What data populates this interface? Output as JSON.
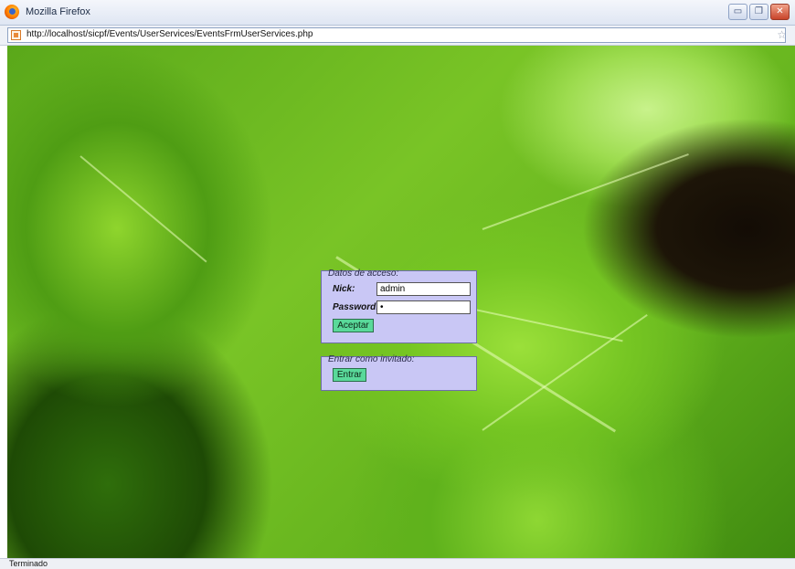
{
  "window": {
    "title": "Mozilla Firefox",
    "buttons": {
      "minimize": "▭",
      "maximize": "❐",
      "close": "✕"
    }
  },
  "address_bar": {
    "url": "http://localhost/sicpf/Events/UserServices/EventsFrmUserServices.php",
    "bookmark_star": "☆"
  },
  "login_form": {
    "legend": "Datos de acceso:",
    "nick_label": "Nick:",
    "nick_value": "admin",
    "password_label": "Password:",
    "password_value": "•",
    "submit_label": "Aceptar"
  },
  "guest_form": {
    "legend": "Entrar como invitado:",
    "submit_label": "Entrar"
  },
  "status_bar": {
    "text": "Terminado"
  },
  "colors": {
    "panel_bg": "#c9c7f5",
    "button_bg": "#59d99a",
    "leaf_green": "#79c426"
  },
  "icons": [
    "firefox-logo-icon",
    "site-favicon-icon",
    "bookmark-star-icon"
  ]
}
